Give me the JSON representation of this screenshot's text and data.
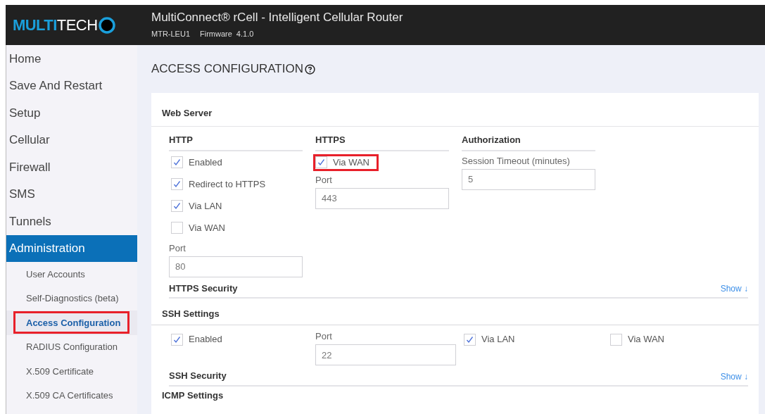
{
  "header": {
    "logo": {
      "bold": "MULTI",
      "light": "TECH"
    },
    "title": "MultiConnect® rCell - Intelligent Cellular Router",
    "model": "MTR-LEU1",
    "firmware_label": "Firmware",
    "firmware_version": "4.1.0"
  },
  "sidebar": {
    "items": [
      {
        "label": "Home",
        "selected": false
      },
      {
        "label": "Save And Restart",
        "selected": false
      },
      {
        "label": "Setup",
        "selected": false
      },
      {
        "label": "Cellular",
        "selected": false
      },
      {
        "label": "Firewall",
        "selected": false
      },
      {
        "label": "SMS",
        "selected": false
      },
      {
        "label": "Tunnels",
        "selected": false
      },
      {
        "label": "Administration",
        "selected": true,
        "children": [
          {
            "label": "User Accounts",
            "selected": false,
            "highlighted": false
          },
          {
            "label": "Self-Diagnostics (beta)",
            "selected": false,
            "highlighted": false
          },
          {
            "label": "Access Configuration",
            "selected": true,
            "highlighted": true
          },
          {
            "label": "RADIUS Configuration",
            "selected": false,
            "highlighted": false
          },
          {
            "label": "X.509 Certificate",
            "selected": false,
            "highlighted": false
          },
          {
            "label": "X.509 CA Certificates",
            "selected": false,
            "highlighted": false
          }
        ]
      }
    ]
  },
  "page_title": "ACCESS CONFIGURATION",
  "web_server": {
    "title": "Web Server",
    "http": {
      "heading": "HTTP",
      "options": [
        {
          "label": "Enabled",
          "checked": true,
          "highlighted": false
        },
        {
          "label": "Redirect to HTTPS",
          "checked": true,
          "highlighted": false
        },
        {
          "label": "Via LAN",
          "checked": true,
          "highlighted": false
        },
        {
          "label": "Via WAN",
          "checked": false,
          "highlighted": false
        }
      ],
      "port": {
        "label": "Port",
        "value": "80"
      }
    },
    "https": {
      "heading": "HTTPS",
      "options": [
        {
          "label": "Via WAN",
          "checked": true,
          "highlighted": true
        }
      ],
      "port": {
        "label": "Port",
        "value": "443"
      }
    },
    "authorization": {
      "heading": "Authorization",
      "session_timeout": {
        "label": "Session Timeout (minutes)",
        "value": "5"
      }
    },
    "https_security": {
      "title": "HTTPS Security",
      "toggle": "Show ↓"
    }
  },
  "ssh_settings": {
    "title": "SSH Settings",
    "enabled": {
      "label": "Enabled",
      "checked": true,
      "highlighted": false
    },
    "port": {
      "label": "Port",
      "value": "22"
    },
    "via_lan": {
      "label": "Via LAN",
      "checked": true,
      "highlighted": false
    },
    "via_wan": {
      "label": "Via WAN",
      "checked": false,
      "highlighted": false
    },
    "ssh_security": {
      "title": "SSH Security",
      "toggle": "Show ↓"
    }
  },
  "icmp_settings": {
    "title": "ICMP Settings"
  }
}
